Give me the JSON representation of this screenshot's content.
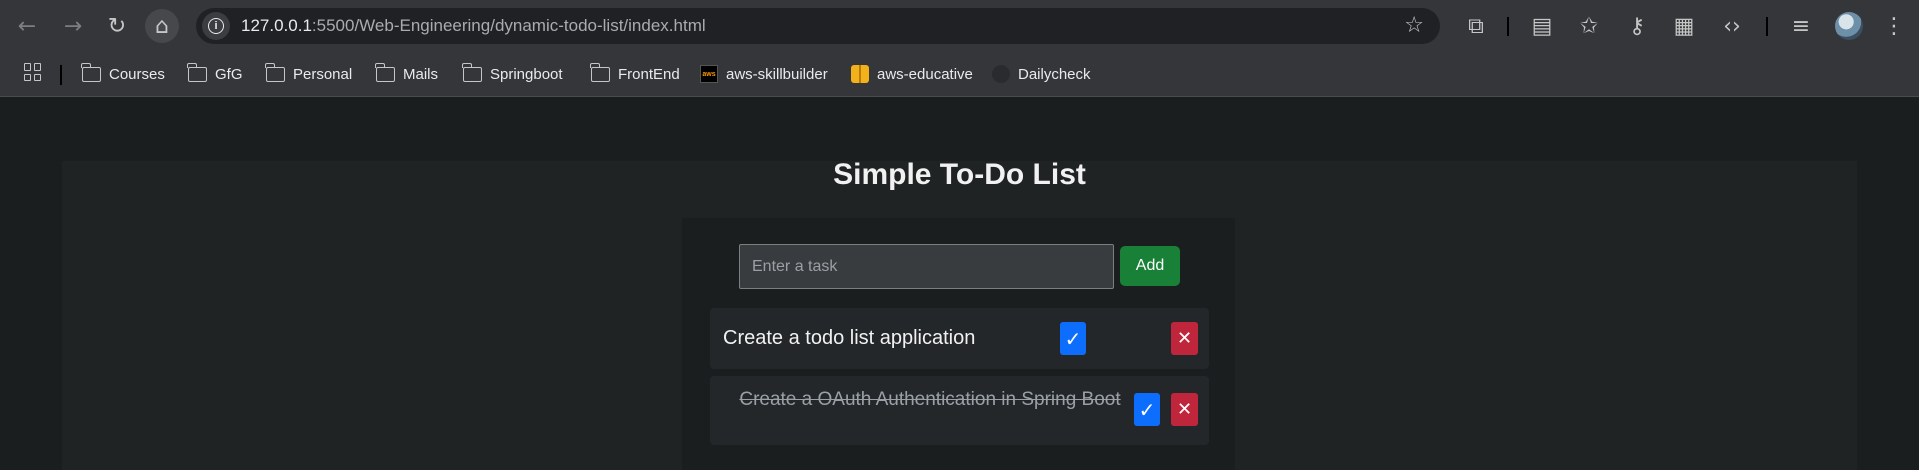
{
  "browser": {
    "url_host": "127.0.0.1",
    "url_path": ":5500/Web-Engineering/dynamic-todo-list/index.html",
    "icons": {
      "back": "←",
      "forward": "→",
      "reload": "↻",
      "home": "⌂",
      "info": "i",
      "star": "☆",
      "extensions": "⧉",
      "reading_list": "▤",
      "bookmark_star": "✩",
      "password": "⚷",
      "qr": "▦",
      "devtools": "‹›",
      "media": "≡",
      "menu": "⋮"
    }
  },
  "bookmarks": [
    {
      "label": "Courses"
    },
    {
      "label": "GfG"
    },
    {
      "label": "Personal"
    },
    {
      "label": "Mails"
    },
    {
      "label": "Springboot"
    },
    {
      "label": "FrontEnd"
    },
    {
      "label": "aws-skillbuilder",
      "icon_text": "aws"
    },
    {
      "label": "aws-educative"
    },
    {
      "label": "Dailycheck"
    }
  ],
  "app": {
    "title": "Simple To-Do List",
    "input_placeholder": "Enter a task",
    "add_label": "Add",
    "done_symbol": "✓",
    "delete_symbol": "✕",
    "tasks": [
      {
        "text": "Create a todo list application",
        "completed": false
      },
      {
        "text": "Create a OAuth Authentication in Spring Boot",
        "completed": true
      }
    ]
  },
  "colors": {
    "add_button": "#198038",
    "done_button": "#0d6efd",
    "delete_button": "#c0263b"
  }
}
